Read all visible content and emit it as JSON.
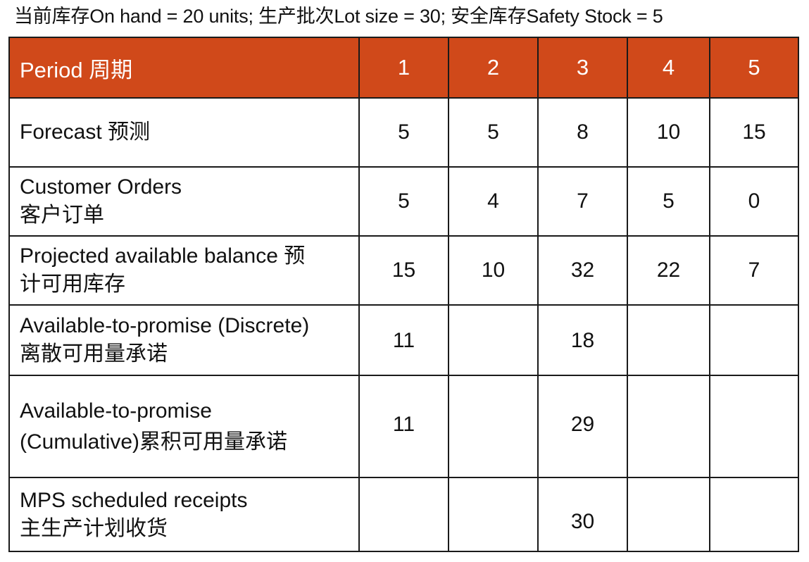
{
  "caption": "当前库存On hand = 20 units; 生产批次Lot size = 30; 安全库存Safety Stock = 5",
  "table": {
    "header": {
      "label": "Period 周期",
      "periods": [
        "1",
        "2",
        "3",
        "4",
        "5"
      ]
    },
    "rows": [
      {
        "label_lines": [
          "Forecast 预测"
        ],
        "values": [
          "5",
          "5",
          "8",
          "10",
          "15"
        ]
      },
      {
        "label_lines": [
          "Customer Orders",
          "客户订单"
        ],
        "values": [
          "5",
          "4",
          "7",
          "5",
          "0"
        ]
      },
      {
        "label_lines": [
          "Projected available balance 预",
          "计可用库存"
        ],
        "values": [
          "15",
          "10",
          "32",
          "22",
          "7"
        ]
      },
      {
        "label_lines": [
          "Available-to-promise (Discrete)",
          "离散可用量承诺"
        ],
        "values": [
          "11",
          "",
          "18",
          "",
          ""
        ]
      },
      {
        "label_lines": [
          "Available-to-promise",
          "(Cumulative)累积可用量承诺"
        ],
        "values": [
          "11",
          "",
          "29",
          "",
          ""
        ]
      },
      {
        "label_lines": [
          "MPS scheduled receipts",
          "主生产计划收货"
        ],
        "values": [
          "",
          "",
          "30",
          "",
          ""
        ]
      }
    ]
  },
  "colors": {
    "header_bg": "#d0491a",
    "header_text": "#ffffff",
    "border": "#1a1a1a"
  }
}
